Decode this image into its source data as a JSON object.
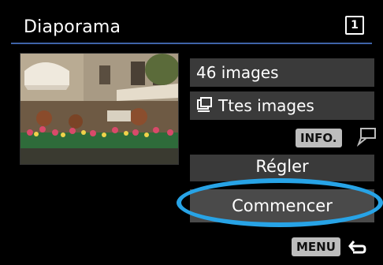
{
  "header": {
    "title": "Diaporama",
    "page_indicator": "1"
  },
  "thumbnail": {
    "subject": "café terrace with awnings and flower boxes"
  },
  "settings": {
    "image_count": "46 images",
    "filter_label": "Ttes images",
    "filter_icon": "all-images-icon"
  },
  "info": {
    "label": "INFO.",
    "icon": "info-menu-icon"
  },
  "buttons": {
    "setup": "Régler",
    "start": "Commencer"
  },
  "footer": {
    "menu_label": "MENU",
    "back_icon": "return-arrow-icon"
  },
  "colors": {
    "accent_line": "#3f63a8",
    "highlight": "#27a3e6",
    "panel": "#3a3a3a"
  }
}
